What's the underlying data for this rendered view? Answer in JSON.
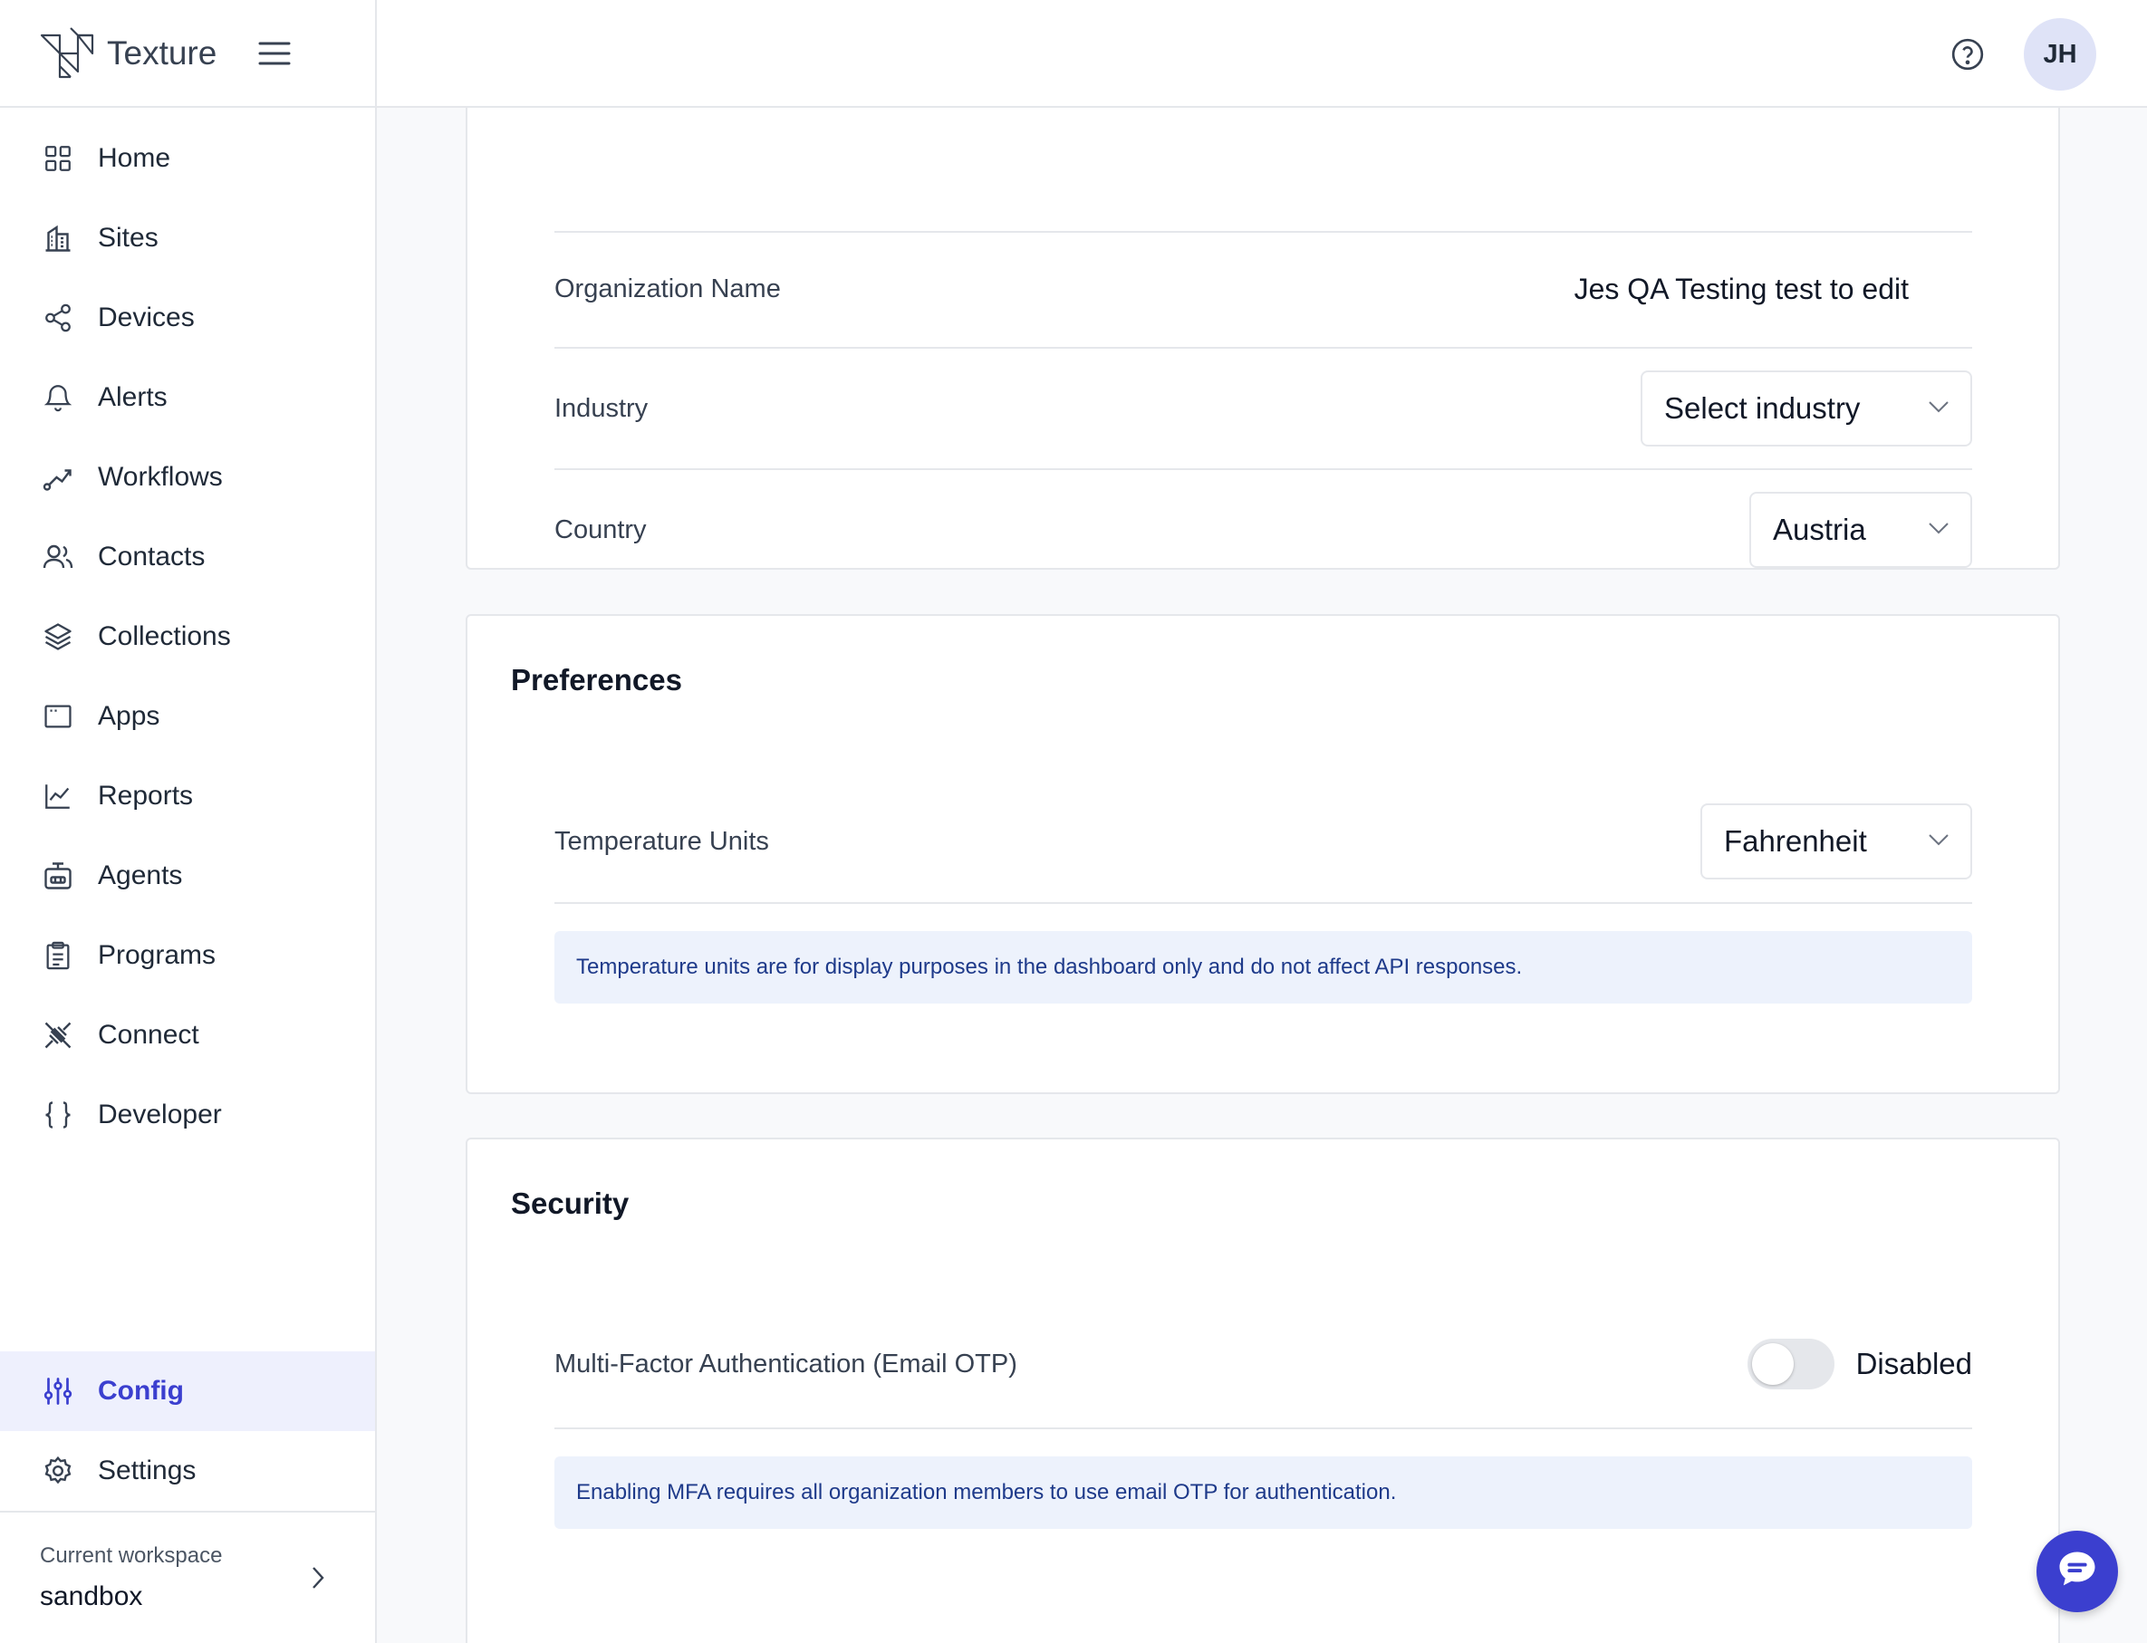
{
  "brand": {
    "name": "Texture"
  },
  "nav": [
    {
      "label": "Home",
      "icon": "grid-icon"
    },
    {
      "label": "Sites",
      "icon": "building-icon"
    },
    {
      "label": "Devices",
      "icon": "share-nodes-icon"
    },
    {
      "label": "Alerts",
      "icon": "bell-icon"
    },
    {
      "label": "Workflows",
      "icon": "workflow-icon"
    },
    {
      "label": "Contacts",
      "icon": "users-icon"
    },
    {
      "label": "Collections",
      "icon": "layers-icon"
    },
    {
      "label": "Apps",
      "icon": "window-icon"
    },
    {
      "label": "Reports",
      "icon": "line-chart-icon"
    },
    {
      "label": "Agents",
      "icon": "robot-icon"
    },
    {
      "label": "Programs",
      "icon": "clipboard-icon"
    },
    {
      "label": "Connect",
      "icon": "plug-icon"
    },
    {
      "label": "Developer",
      "icon": "braces-icon"
    }
  ],
  "bottom_nav": [
    {
      "label": "Config",
      "icon": "sliders-icon",
      "active": true
    },
    {
      "label": "Settings",
      "icon": "gear-icon",
      "active": false
    }
  ],
  "workspace": {
    "caption": "Current workspace",
    "value": "sandbox"
  },
  "header": {
    "avatar_initials": "JH"
  },
  "organization": {
    "name_label": "Organization Name",
    "name_value": "Jes QA Testing test to edit",
    "industry_label": "Industry",
    "industry_value": "Select industry",
    "country_label": "Country",
    "country_value": "Austria"
  },
  "preferences": {
    "title": "Preferences",
    "temp_label": "Temperature Units",
    "temp_value": "Fahrenheit",
    "info": "Temperature units are for display purposes in the dashboard only and do not affect API responses."
  },
  "security": {
    "title": "Security",
    "mfa_label": "Multi-Factor Authentication (Email OTP)",
    "mfa_status": "Disabled",
    "mfa_enabled": false,
    "info": "Enabling MFA requires all organization members to use email OTP for authentication."
  },
  "colors": {
    "accent": "#3b3fcf",
    "info_bg": "#edf2fc",
    "info_text": "#1e3a8a"
  }
}
